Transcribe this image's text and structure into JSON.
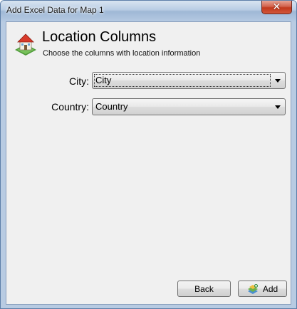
{
  "window": {
    "title": "Add Excel Data for Map 1",
    "close_glyph": "✕"
  },
  "header": {
    "icon": "house-map-icon",
    "title": "Location Columns",
    "subtitle": "Choose the columns with location information"
  },
  "fields": {
    "city": {
      "label": "City:",
      "value": "City"
    },
    "country": {
      "label": "Country:",
      "value": "Country"
    }
  },
  "buttons": {
    "back_label": "Back",
    "add_label": "Add",
    "add_icon": "add-data-icon"
  },
  "colors": {
    "title_bar": "#b9cde4",
    "client_bg": "#f0f0f0",
    "close_button": "#c2391c"
  }
}
